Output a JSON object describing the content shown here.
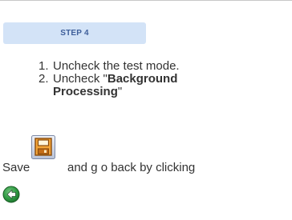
{
  "step": {
    "label": "STEP 4"
  },
  "instructions": {
    "item1_num": "1.",
    "item1_text": "Uncheck the test mode.",
    "item2_num": "2.",
    "item2_prefix": "Uncheck \"",
    "item2_bold_line1": "Background",
    "item2_bold_line2": "Processing",
    "item2_suffix": "\""
  },
  "save_line": {
    "prefix": "Save",
    "suffix": "and g o back by clicking"
  },
  "icons": {
    "save": "save-icon",
    "back": "back-arrow-icon"
  },
  "colors": {
    "badge_background": "#d3e3f7",
    "badge_text": "#3f5f9a",
    "body_text": "#333333",
    "rule": "#c8c8c8"
  }
}
